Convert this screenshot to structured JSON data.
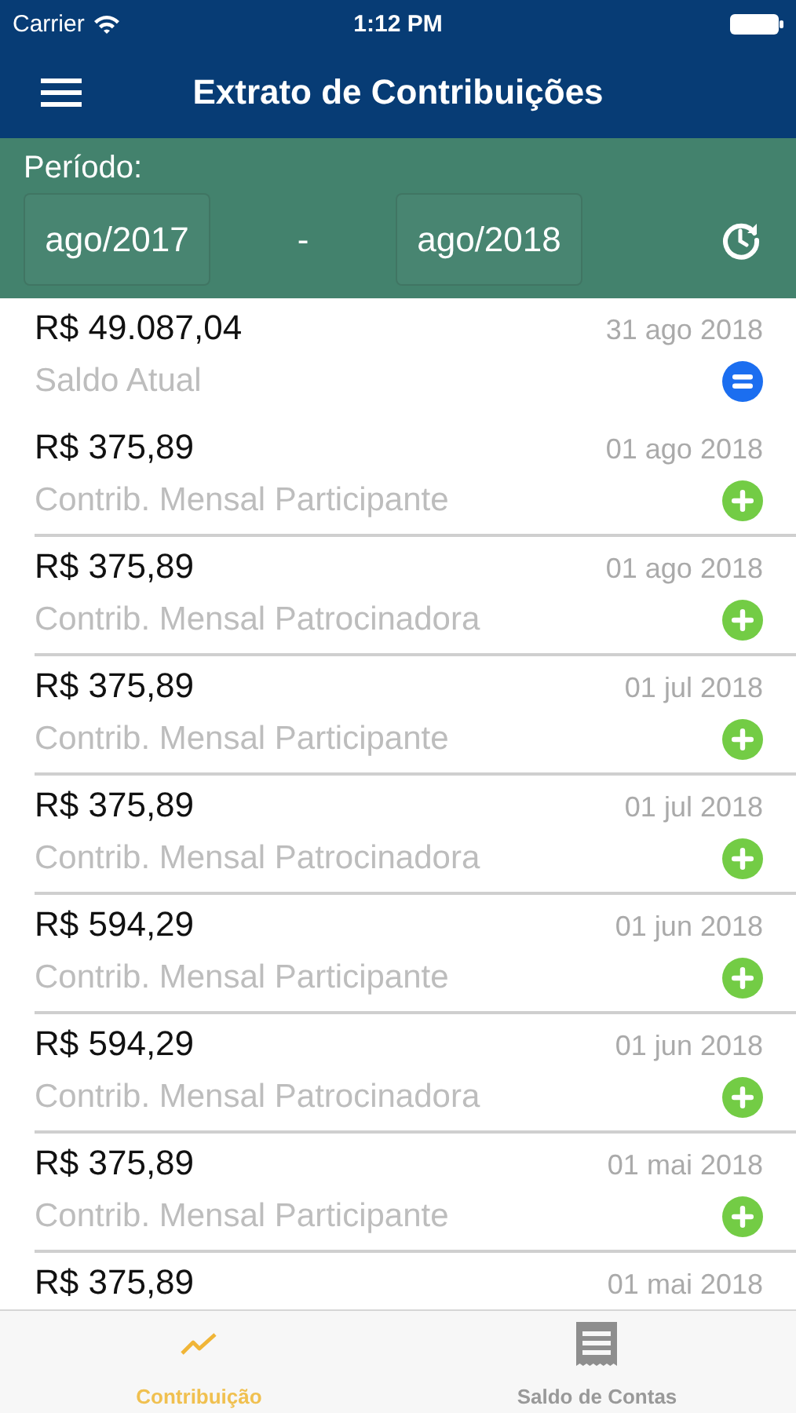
{
  "status_bar": {
    "carrier": "Carrier",
    "time": "1:12 PM"
  },
  "header": {
    "title": "Extrato de Contribuições"
  },
  "period": {
    "label": "Período:",
    "from": "ago/2017",
    "separator": "-",
    "to": "ago/2018"
  },
  "entries": [
    {
      "kind": "balance",
      "amount": "R$ 49.087,04",
      "date": "31 ago 2018",
      "description": "Saldo Atual"
    },
    {
      "kind": "credit",
      "amount": "R$ 375,89",
      "date": "01 ago 2018",
      "description": "Contrib. Mensal Participante"
    },
    {
      "kind": "credit",
      "amount": "R$ 375,89",
      "date": "01 ago 2018",
      "description": "Contrib. Mensal Patrocinadora"
    },
    {
      "kind": "credit",
      "amount": "R$ 375,89",
      "date": "01 jul 2018",
      "description": "Contrib. Mensal Participante"
    },
    {
      "kind": "credit",
      "amount": "R$ 375,89",
      "date": "01 jul 2018",
      "description": "Contrib. Mensal Patrocinadora"
    },
    {
      "kind": "credit",
      "amount": "R$ 594,29",
      "date": "01 jun 2018",
      "description": "Contrib. Mensal Participante"
    },
    {
      "kind": "credit",
      "amount": "R$ 594,29",
      "date": "01 jun 2018",
      "description": "Contrib. Mensal Patrocinadora"
    },
    {
      "kind": "credit",
      "amount": "R$ 375,89",
      "date": "01 mai 2018",
      "description": "Contrib. Mensal Participante"
    },
    {
      "kind": "partial",
      "amount": "R$ 375,89",
      "date": "01 mai 2018"
    }
  ],
  "tab_bar": [
    {
      "label": "Contribuição",
      "kind": "chart",
      "selected": true
    },
    {
      "label": "Saldo de Contas",
      "kind": "statement",
      "selected": false
    }
  ]
}
